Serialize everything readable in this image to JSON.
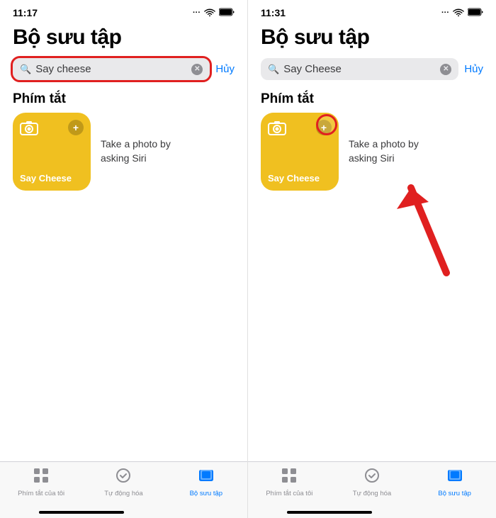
{
  "left_panel": {
    "status": {
      "time": "11:17",
      "signal": "···",
      "wifi": "wifi",
      "battery": "battery"
    },
    "title": "Bộ sưu tập",
    "search": {
      "placeholder": "Say cheese",
      "value": "Say cheese",
      "cancel_label": "Hủy"
    },
    "section": "Phím tắt",
    "shortcut": {
      "name": "Say Cheese",
      "desc_line1": "Take a photo by",
      "desc_line2": "asking Siri"
    },
    "tabs": [
      {
        "label": "Phím tắt của tôi",
        "icon": "⊞",
        "active": false
      },
      {
        "label": "Tự động hóa",
        "icon": "✓",
        "active": false
      },
      {
        "label": "Bộ sưu tập",
        "icon": "⧉",
        "active": true
      }
    ]
  },
  "right_panel": {
    "status": {
      "time": "11:31",
      "signal": "···",
      "wifi": "wifi",
      "battery": "battery"
    },
    "title": "Bộ sưu tập",
    "search": {
      "placeholder": "Say Cheese",
      "value": "Say Cheese",
      "cancel_label": "Hủy"
    },
    "section": "Phím tắt",
    "shortcut": {
      "name": "Say Cheese",
      "desc_line1": "Take a photo by",
      "desc_line2": "asking Siri"
    },
    "tabs": [
      {
        "label": "Phím tắt của tôi",
        "icon": "⊞",
        "active": false
      },
      {
        "label": "Tự động hóa",
        "icon": "✓",
        "active": false
      },
      {
        "label": "Bộ sưu tập",
        "icon": "⧉",
        "active": true
      }
    ]
  }
}
